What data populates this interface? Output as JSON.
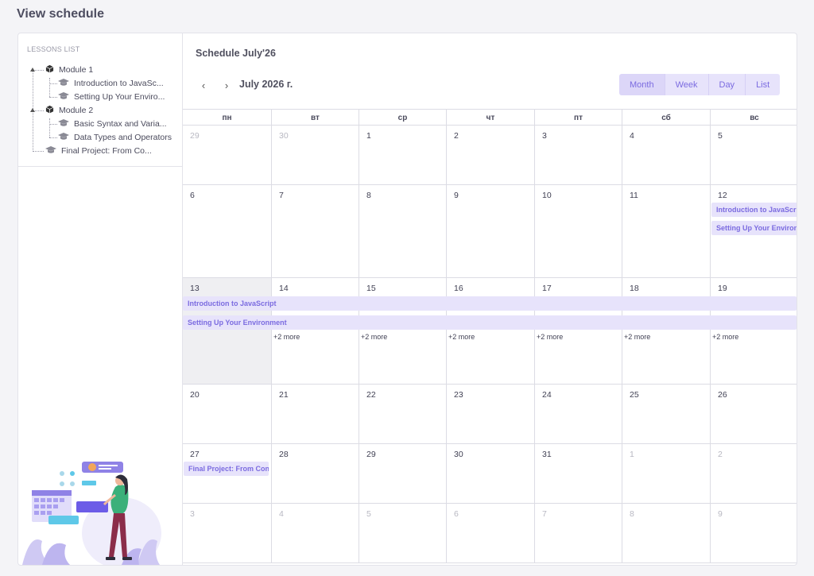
{
  "page": {
    "title": "View schedule"
  },
  "sidebar": {
    "heading": "LESSONS LIST",
    "items": [
      {
        "label": "Module 1",
        "icon": "cube-icon",
        "level": 0
      },
      {
        "label": "Introduction to JavaSc...",
        "icon": "graduation-cap-icon",
        "level": 1
      },
      {
        "label": "Setting Up Your Enviro...",
        "icon": "graduation-cap-icon",
        "level": 1
      },
      {
        "label": "Module 2",
        "icon": "cube-icon",
        "level": 0
      },
      {
        "label": "Basic Syntax and Varia...",
        "icon": "graduation-cap-icon",
        "level": 1
      },
      {
        "label": "Data Types and Operators",
        "icon": "graduation-cap-icon",
        "level": 1
      },
      {
        "label": "Final Project: From Co...",
        "icon": "graduation-cap-icon",
        "level": 0
      }
    ]
  },
  "schedule": {
    "title": "Schedule July'26",
    "month_label": "July 2026 г.",
    "views": [
      "Month",
      "Week",
      "Day",
      "List"
    ],
    "active_view": "Month",
    "weekdays": [
      "пн",
      "вт",
      "ср",
      "чт",
      "пт",
      "сб",
      "вс"
    ],
    "weeks": [
      [
        "29",
        "30",
        "1",
        "2",
        "3",
        "4",
        "5"
      ],
      [
        "6",
        "7",
        "8",
        "9",
        "10",
        "11",
        "12"
      ],
      [
        "13",
        "14",
        "15",
        "16",
        "17",
        "18",
        "19"
      ],
      [
        "20",
        "21",
        "22",
        "23",
        "24",
        "25",
        "26"
      ],
      [
        "27",
        "28",
        "29",
        "30",
        "31",
        "1",
        "2"
      ],
      [
        "3",
        "4",
        "5",
        "6",
        "7",
        "8",
        "9"
      ]
    ],
    "events": {
      "week2_a": "Introduction to JavaScript",
      "week2_b": "Setting Up Your Environment",
      "week3_a": "Introduction to JavaScript",
      "week3_b": "Setting Up Your Environment",
      "week5_a": "Final Project: From Concept to Code"
    },
    "more_label": "+2 more"
  },
  "colors": {
    "accent": "#7b6be0",
    "event_bg": "#e7e3fb",
    "today_bg": "#efeff2"
  }
}
